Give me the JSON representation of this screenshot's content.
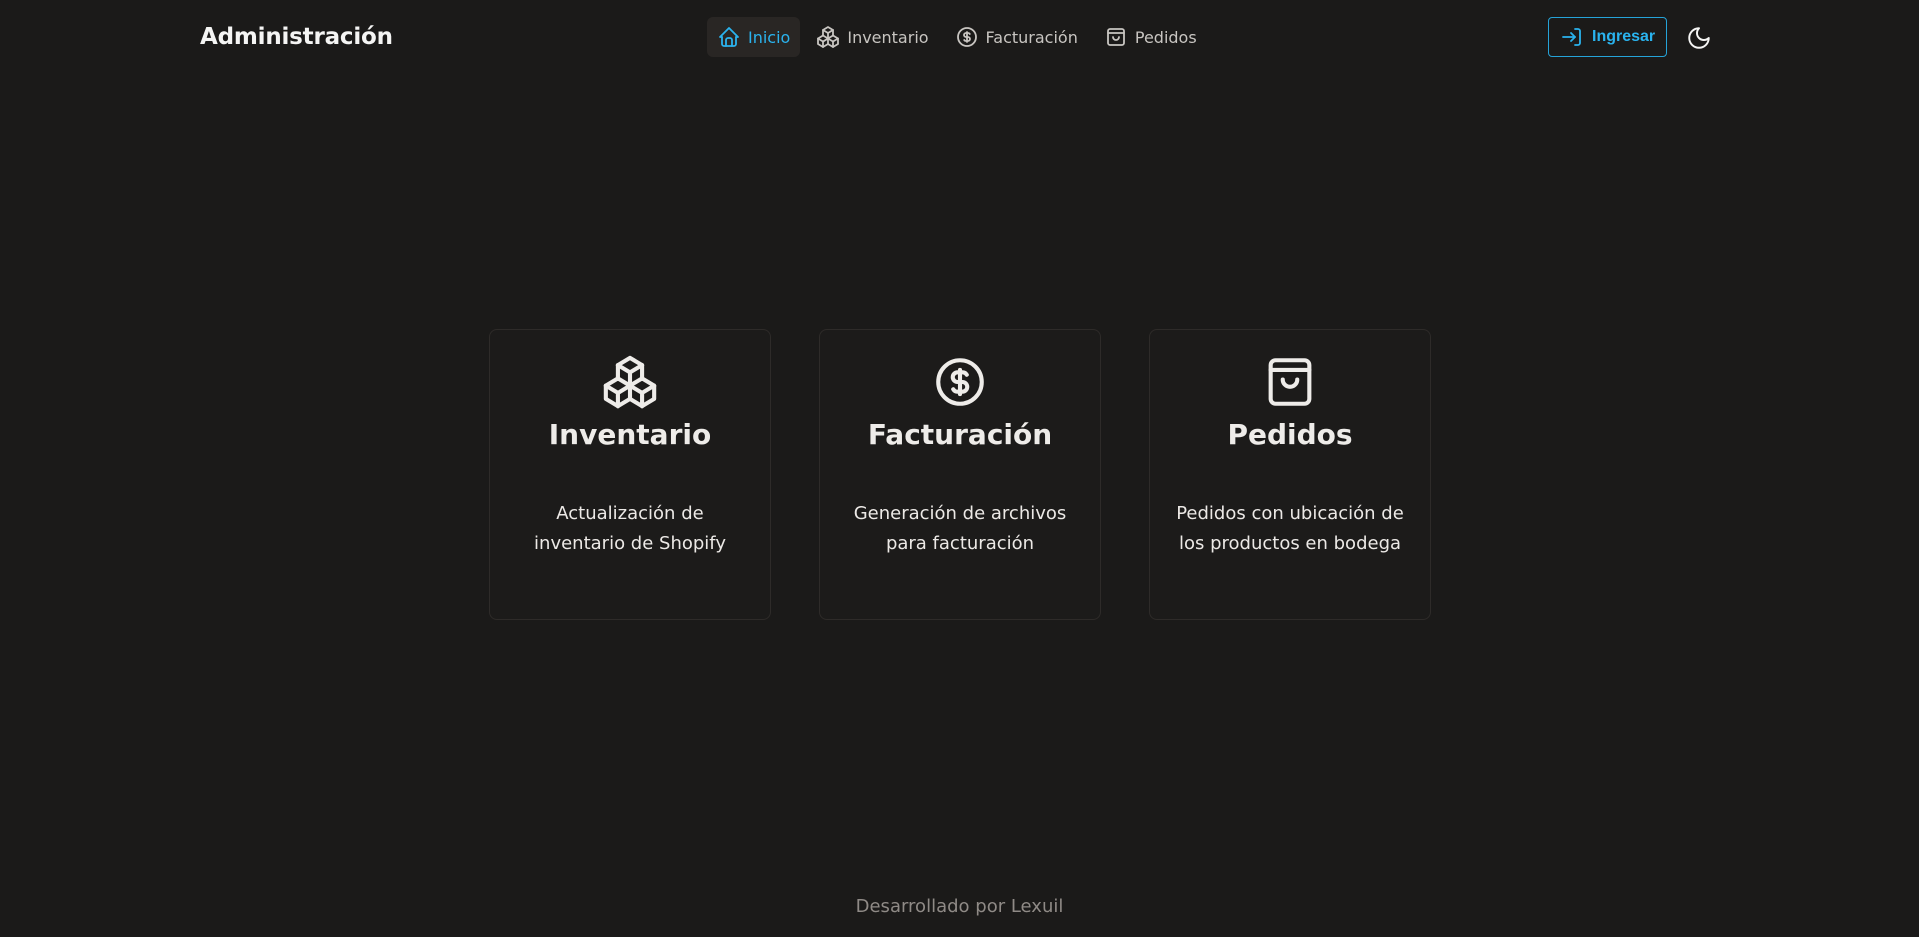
{
  "header": {
    "brand": "Administración",
    "nav": [
      {
        "label": "Inicio",
        "icon": "home-icon",
        "active": true
      },
      {
        "label": "Inventario",
        "icon": "boxes-icon",
        "active": false
      },
      {
        "label": "Facturación",
        "icon": "dollar-circle-icon",
        "active": false
      },
      {
        "label": "Pedidos",
        "icon": "shopping-bag-icon",
        "active": false
      }
    ],
    "login_label": "Ingresar",
    "login_icon": "login-icon",
    "theme_icon": "moon-icon"
  },
  "cards": [
    {
      "title": "Inventario",
      "icon": "boxes-icon",
      "description": "Actualización de inventario de Shopify"
    },
    {
      "title": "Facturación",
      "icon": "dollar-circle-icon",
      "description": "Generación de archivos para facturación"
    },
    {
      "title": "Pedidos",
      "icon": "shopping-bag-icon",
      "description": "Pedidos con ubicación de los productos en bodega"
    }
  ],
  "footer": {
    "text": "Desarrollado por Lexuil"
  },
  "colors": {
    "background": "#1b1a19",
    "accent": "#2ab3ee",
    "card_border": "#2e2b29",
    "nav_active_bg": "#292624"
  }
}
